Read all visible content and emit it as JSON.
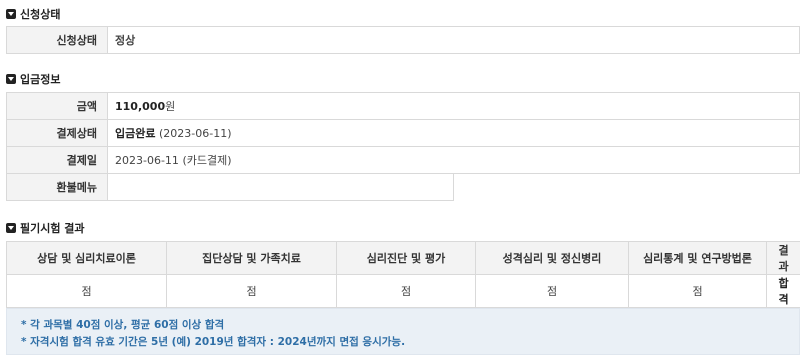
{
  "sections": {
    "application": {
      "title": "신청상태",
      "rows": [
        {
          "label": "신청상태",
          "value": "정상"
        }
      ]
    },
    "payment": {
      "title": "입금정보",
      "amount_label": "금액",
      "amount_value": "110,000",
      "amount_unit": "원",
      "pay_status_label": "결제상태",
      "pay_status_value": "입금완료",
      "pay_status_date": "(2023-06-11)",
      "pay_date_label": "결제일",
      "pay_date_value": "2023-06-11",
      "pay_method": "(카드결제)",
      "refund_label": "환불메뉴"
    },
    "exam": {
      "title": "필기시험 결과",
      "headers": [
        "상담 및 심리치료이론",
        "집단상담 및 가족치료",
        "심리진단 및 평가",
        "성격심리 및 정신병리",
        "심리통계 및 연구방법론",
        "결과"
      ],
      "scores": [
        "점",
        "점",
        "점",
        "점",
        "점"
      ],
      "result": "합격"
    }
  },
  "notice": {
    "line1": "* 각 과목별 40점 이상, 평균 60점 이상 합격",
    "line2": "* 자격시험 합격 유효 기간은 5년 (예) 2019년 합격자 : 2024년까지 면접 응시가능."
  }
}
